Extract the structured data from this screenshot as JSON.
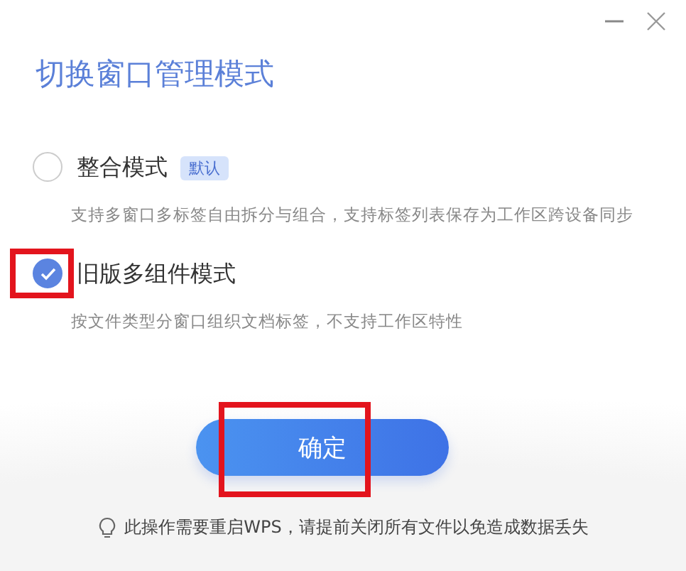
{
  "window": {
    "title": "切换窗口管理模式"
  },
  "options": [
    {
      "label": "整合模式",
      "badge": "默认",
      "description": "支持多窗口多标签自由拆分与组合，支持标签列表保存为工作区跨设备同步",
      "selected": false,
      "highlighted": false
    },
    {
      "label": "旧版多组件模式",
      "description": "按文件类型分窗口组织文档标签，不支持工作区特性",
      "selected": true,
      "highlighted": true
    }
  ],
  "confirm_button": {
    "label": "确定",
    "highlighted": true
  },
  "tip": "此操作需要重启WPS，请提前关闭所有文件以免造成数据丢失"
}
